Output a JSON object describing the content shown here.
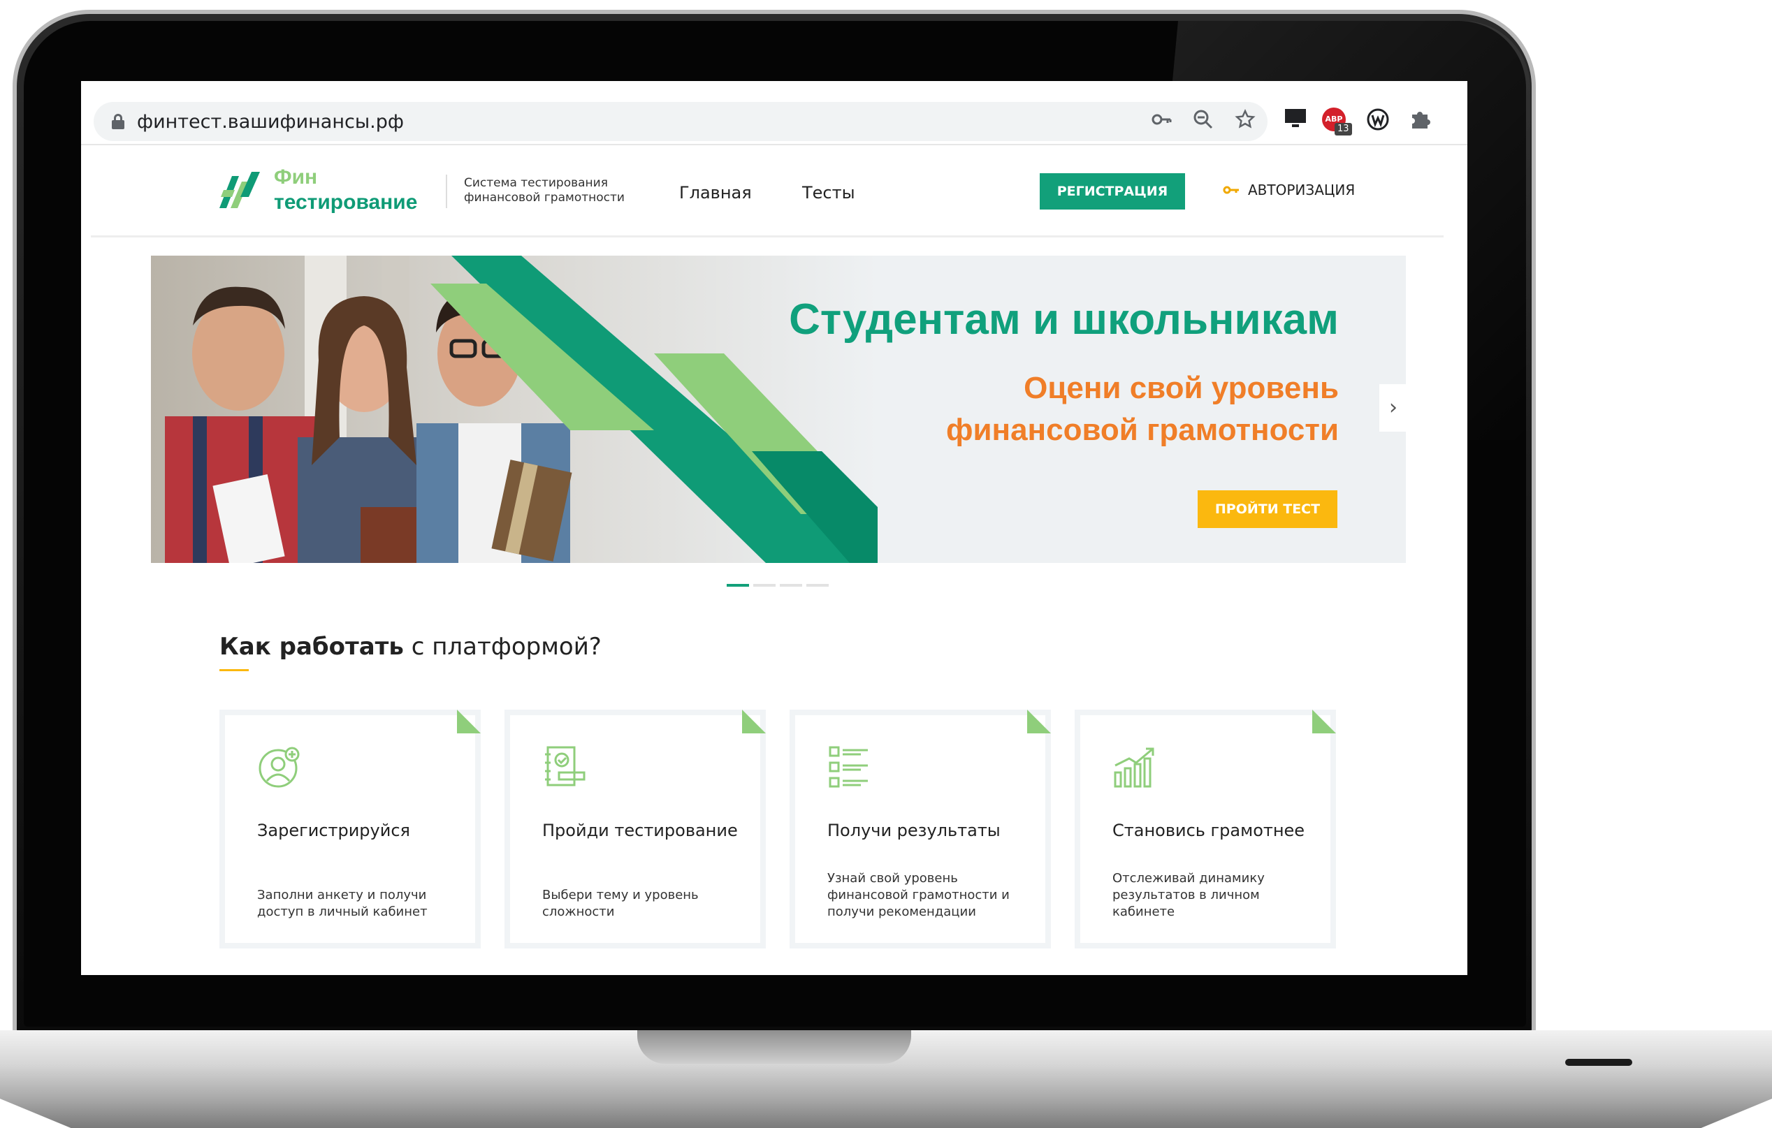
{
  "browser": {
    "url": "финтест.вашифинансы.рф",
    "abp_count": "13",
    "abp_label": "ABP"
  },
  "header": {
    "logo_line1": "Фин",
    "logo_line2": "тестирование",
    "tagline": "Система тестирования финансовой грамотности",
    "nav": [
      "Главная",
      "Тесты"
    ],
    "register": "РЕГИСТРАЦИЯ",
    "login": "АВТОРИЗАЦИЯ"
  },
  "banner": {
    "title": "Студентам и школьникам",
    "subtitle": "Оцени свой уровень финансовой грамотности",
    "cta": "ПРОЙТИ ТЕСТ",
    "slides_total": 4,
    "slide_active": 1
  },
  "how": {
    "title_bold": "Как работать",
    "title_rest": " с платформой?",
    "cards": [
      {
        "title": "Зарегистрируйся",
        "desc": "Заполни анкету и получи доступ в личный кабинет"
      },
      {
        "title": "Пройди тестирование",
        "desc": "Выбери тему и уровень сложности"
      },
      {
        "title": "Получи результаты",
        "desc": "Узнай свой уровень финансовой грамотности и получи рекомендации"
      },
      {
        "title": "Становись грамотнее",
        "desc": "Отслеживай динамику результатов в личном кабинете"
      }
    ]
  },
  "colors": {
    "brand_green": "#12a07a",
    "light_green": "#8fce7b",
    "orange": "#f07e28",
    "yellow": "#fbb80f"
  }
}
